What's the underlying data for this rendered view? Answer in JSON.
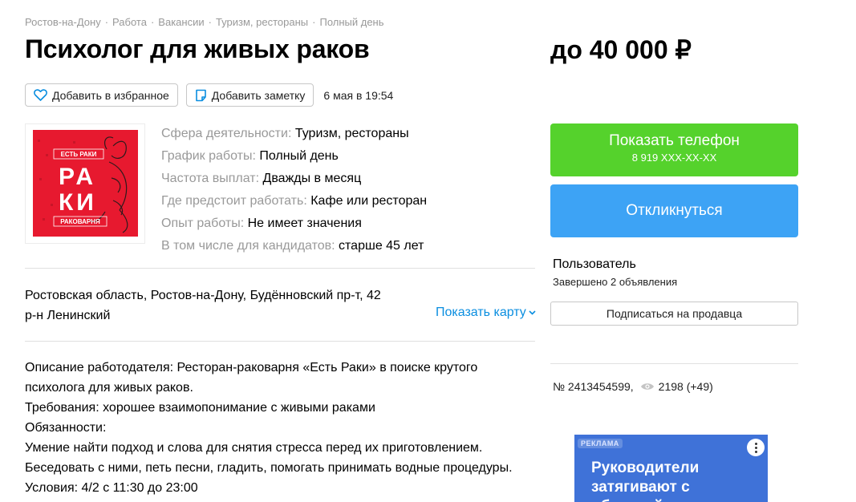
{
  "breadcrumbs": [
    "Ростов-на-Дону",
    "Работа",
    "Вакансии",
    "Туризм, рестораны",
    "Полный день"
  ],
  "breadcrumb_separator": "·",
  "title": "Психолог для живых раков",
  "price": "до 40 000 ₽",
  "actions": {
    "favorite_label": "Добавить в избранное",
    "note_label": "Добавить заметку",
    "date": "6 мая в 19:54"
  },
  "logo": {
    "top_text": "ЕСТЬ РАКИ",
    "word_line1": "РА",
    "word_line2": "КИ",
    "bottom_text": "РАКОВАРНЯ",
    "background_color": "#e7192f"
  },
  "params": [
    {
      "key": "Сфера деятельности: ",
      "value": "Туризм, рестораны"
    },
    {
      "key": "График работы: ",
      "value": "Полный день"
    },
    {
      "key": "Частота выплат: ",
      "value": "Дважды в месяц"
    },
    {
      "key": "Где предстоит работать: ",
      "value": "Кафе или ресторан"
    },
    {
      "key": "Опыт работы: ",
      "value": "Не имеет значения"
    },
    {
      "key": "В том числе для кандидатов: ",
      "value": "старше 45 лет"
    }
  ],
  "address": {
    "line1": "Ростовская область, Ростов-на-Дону, Будённовский пр-т, 42",
    "line2": "р-н Ленинский",
    "show_map_label": "Показать карту"
  },
  "description": [
    "Описание работодателя: Ресторан-раковарня «Есть Раки» в поиске крутого",
    "психолога для живых раков.",
    "Требования: хорошее взаимопонимание с живыми раками",
    "Обязанности:",
    "Умение найти подход и слова для снятия стресса перед их приготовлением.",
    "Беседовать с ними, петь песни, гладить, помогать принимать водные процедуры.",
    "Условия: 4/2 с 11:30 до 23:00"
  ],
  "phone_button": {
    "label": "Показать телефон",
    "number": "8 919 XXX-XX-XX",
    "color": "#55d22c"
  },
  "respond_button": {
    "label": "Откликнуться",
    "color": "#3da3f5"
  },
  "seller": {
    "name": "Пользователь",
    "stats": "Завершено 2 объявления",
    "subscribe_label": "Подписаться на продавца"
  },
  "meta": {
    "item_number": "№ 2413454599,",
    "views": "2198 (+49)",
    "views_icon": "eye-icon"
  },
  "ad": {
    "badge": "РЕКЛАМА",
    "text": "Руководители затягивают с обратной связью по",
    "color": "#3f72d8"
  }
}
